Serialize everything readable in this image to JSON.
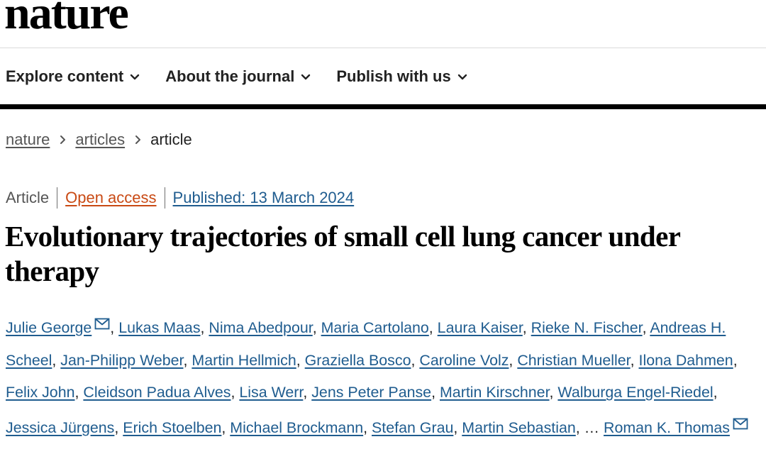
{
  "header": {
    "logo": "nature"
  },
  "nav": {
    "items": [
      {
        "label": "Explore content",
        "icon": "chevron-down-icon"
      },
      {
        "label": "About the journal",
        "icon": "chevron-down-icon"
      },
      {
        "label": "Publish with us",
        "icon": "chevron-down-icon"
      }
    ]
  },
  "breadcrumb": {
    "items": [
      "nature",
      "articles",
      "article"
    ],
    "separator_icon": "chevron-right-icon"
  },
  "article": {
    "type": "Article",
    "access": "Open access",
    "published": "Published: 13 March 2024",
    "title": "Evolutionary trajectories of small cell lung cancer under therapy",
    "authors": [
      {
        "name": "Julie George",
        "email_icon": true
      },
      {
        "name": "Lukas Maas"
      },
      {
        "name": "Nima Abedpour"
      },
      {
        "name": "Maria Cartolano"
      },
      {
        "name": "Laura Kaiser"
      },
      {
        "name": "Rieke N. Fischer"
      },
      {
        "name": "Andreas H. Scheel"
      },
      {
        "name": "Jan-Philipp Weber"
      },
      {
        "name": "Martin Hellmich"
      },
      {
        "name": "Graziella Bosco"
      },
      {
        "name": "Caroline Volz"
      },
      {
        "name": "Christian Mueller"
      },
      {
        "name": "Ilona Dahmen"
      },
      {
        "name": "Felix John"
      },
      {
        "name": "Cleidson Padua Alves"
      },
      {
        "name": "Lisa Werr"
      },
      {
        "name": "Jens Peter Panse"
      },
      {
        "name": "Martin Kirschner"
      },
      {
        "name": "Walburga Engel-Riedel"
      },
      {
        "name": "Jessica Jürgens"
      },
      {
        "name": "Erich Stoelben"
      },
      {
        "name": "Michael Brockmann"
      },
      {
        "name": "Stefan Grau"
      },
      {
        "name": "Martin Sebastian"
      }
    ],
    "authors_ellipsis": "…",
    "last_author": {
      "name": "Roman K. Thomas",
      "email_icon": true
    }
  },
  "colors": {
    "link": "#1f5c8f",
    "open_access": "#c94a14",
    "muted": "#555555",
    "text": "#222222",
    "rule": "#000000"
  }
}
